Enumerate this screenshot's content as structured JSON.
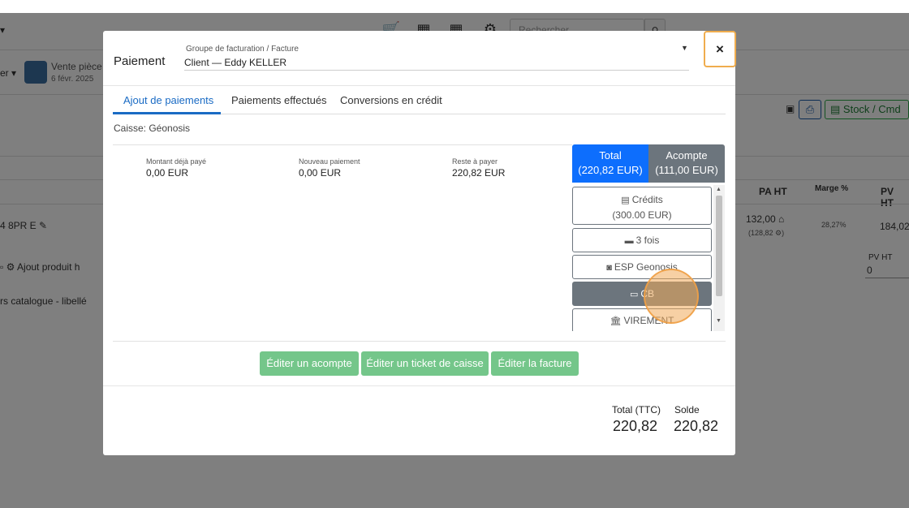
{
  "background": {
    "search_placeholder": "Rechercher",
    "vente_title": "Vente pièce",
    "vente_date": "6 févr. 2025",
    "er_label": "er",
    "stock_button": "Stock / Cmd",
    "columns": {
      "pa_ht": "PA HT",
      "marge": "Marge %",
      "pv_ht": "PV HT"
    },
    "row": {
      "ref": "4 8PR E",
      "pa_ht": "132,00",
      "pa_ht_sub": "(128,82",
      "marge": "28,27%",
      "pv_ht": "184,02"
    },
    "add_product": "Ajout produit h",
    "catalog_label": "rs catalogue - libellé",
    "pv_ht_field_label": "PV HT",
    "pv_ht_field_value": "0"
  },
  "modal": {
    "title": "Paiement",
    "billing_label": "Groupe de facturation / Facture",
    "billing_value": "Client — Eddy KELLER",
    "close_label": "×",
    "tabs": [
      {
        "label": "Ajout de paiements",
        "active": true
      },
      {
        "label": "Paiements effectués",
        "active": false
      },
      {
        "label": "Conversions en crédit",
        "active": false
      }
    ],
    "caisse": "Caisse: Géonosis",
    "stats": [
      {
        "label": "Montant déjà payé",
        "value": "0,00 EUR"
      },
      {
        "label": "Nouveau paiement",
        "value": "0,00 EUR"
      },
      {
        "label": "Reste à payer",
        "value": "220,82 EUR"
      }
    ],
    "pay_tabs": {
      "total_title": "Total",
      "total_amount": "(220,82 EUR)",
      "acompte_title": "Acompte",
      "acompte_amount": "(111,00 EUR)"
    },
    "methods": [
      {
        "label": "Crédits",
        "sub": "(300.00 EUR)",
        "icon": "receipt-icon"
      },
      {
        "label": "3 fois",
        "icon": "card-icon"
      },
      {
        "label": "ESP Geonosis",
        "icon": "cash-icon"
      },
      {
        "label": "CB",
        "icon": "credit-card-icon",
        "active": true
      },
      {
        "label": "VIREMENT",
        "icon": "bank-icon"
      }
    ],
    "actions": {
      "acompte": "Éditer un acompte",
      "ticket": "Éditer un ticket de caisse",
      "facture": "Éditer la facture"
    },
    "totals": {
      "total_label": "Total (TTC)",
      "total_value": "220,82",
      "solde_label": "Solde",
      "solde_value": "220,82"
    }
  },
  "colors": {
    "primary": "#0d6efd",
    "secondary": "#6c757d",
    "success_light": "#74c68a",
    "focus": "#f0ad4e"
  }
}
